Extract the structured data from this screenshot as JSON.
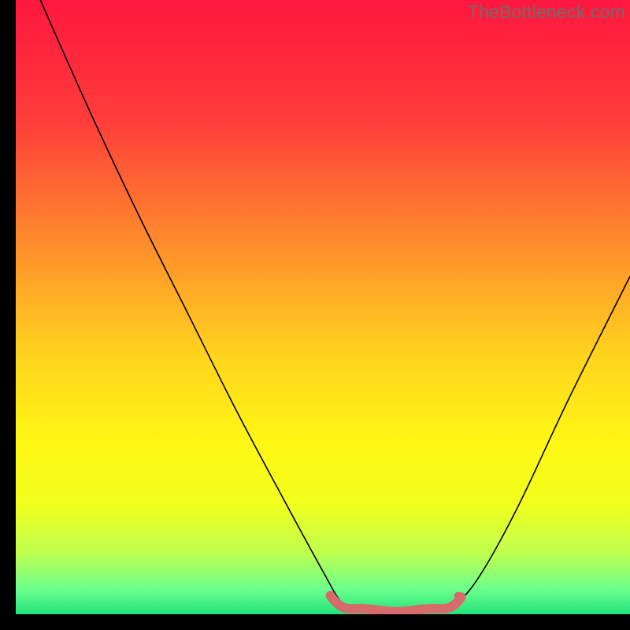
{
  "watermark": {
    "text": "TheBottleneck.com"
  },
  "chart_data": {
    "type": "line",
    "title": "",
    "xlabel": "",
    "ylabel": "",
    "xlim": [
      0,
      100
    ],
    "ylim": [
      0,
      100
    ],
    "grid": false,
    "legend": false,
    "background_gradient": {
      "stops": [
        {
          "offset": 0.0,
          "color": "#ff173f"
        },
        {
          "offset": 0.2,
          "color": "#ff3e3a"
        },
        {
          "offset": 0.4,
          "color": "#ff8e2b"
        },
        {
          "offset": 0.58,
          "color": "#ffd41e"
        },
        {
          "offset": 0.72,
          "color": "#fff714"
        },
        {
          "offset": 0.82,
          "color": "#f2ff1d"
        },
        {
          "offset": 0.9,
          "color": "#bfff4e"
        },
        {
          "offset": 0.96,
          "color": "#6bff8d"
        },
        {
          "offset": 1.0,
          "color": "#22e27a"
        }
      ]
    },
    "series": [
      {
        "name": "bottleneck-curve",
        "color": "#000000",
        "width": 1.6,
        "points": [
          {
            "x": 4,
            "y": 100
          },
          {
            "x": 12,
            "y": 82
          },
          {
            "x": 20,
            "y": 65
          },
          {
            "x": 28,
            "y": 49
          },
          {
            "x": 36,
            "y": 33
          },
          {
            "x": 44,
            "y": 18
          },
          {
            "x": 50,
            "y": 7
          },
          {
            "x": 53,
            "y": 2
          },
          {
            "x": 56,
            "y": 0.5
          },
          {
            "x": 62,
            "y": 0.3
          },
          {
            "x": 68,
            "y": 0.5
          },
          {
            "x": 72,
            "y": 2
          },
          {
            "x": 76,
            "y": 7
          },
          {
            "x": 82,
            "y": 18
          },
          {
            "x": 90,
            "y": 35
          },
          {
            "x": 100,
            "y": 55
          }
        ]
      }
    ],
    "annotations": {
      "optimal_band": {
        "color": "#d76b6b",
        "shape": "rounded-squiggle",
        "x_start": 52,
        "x_end": 72,
        "y": 1,
        "dot": {
          "x": 72,
          "y": 3,
          "r": 5
        }
      }
    }
  }
}
